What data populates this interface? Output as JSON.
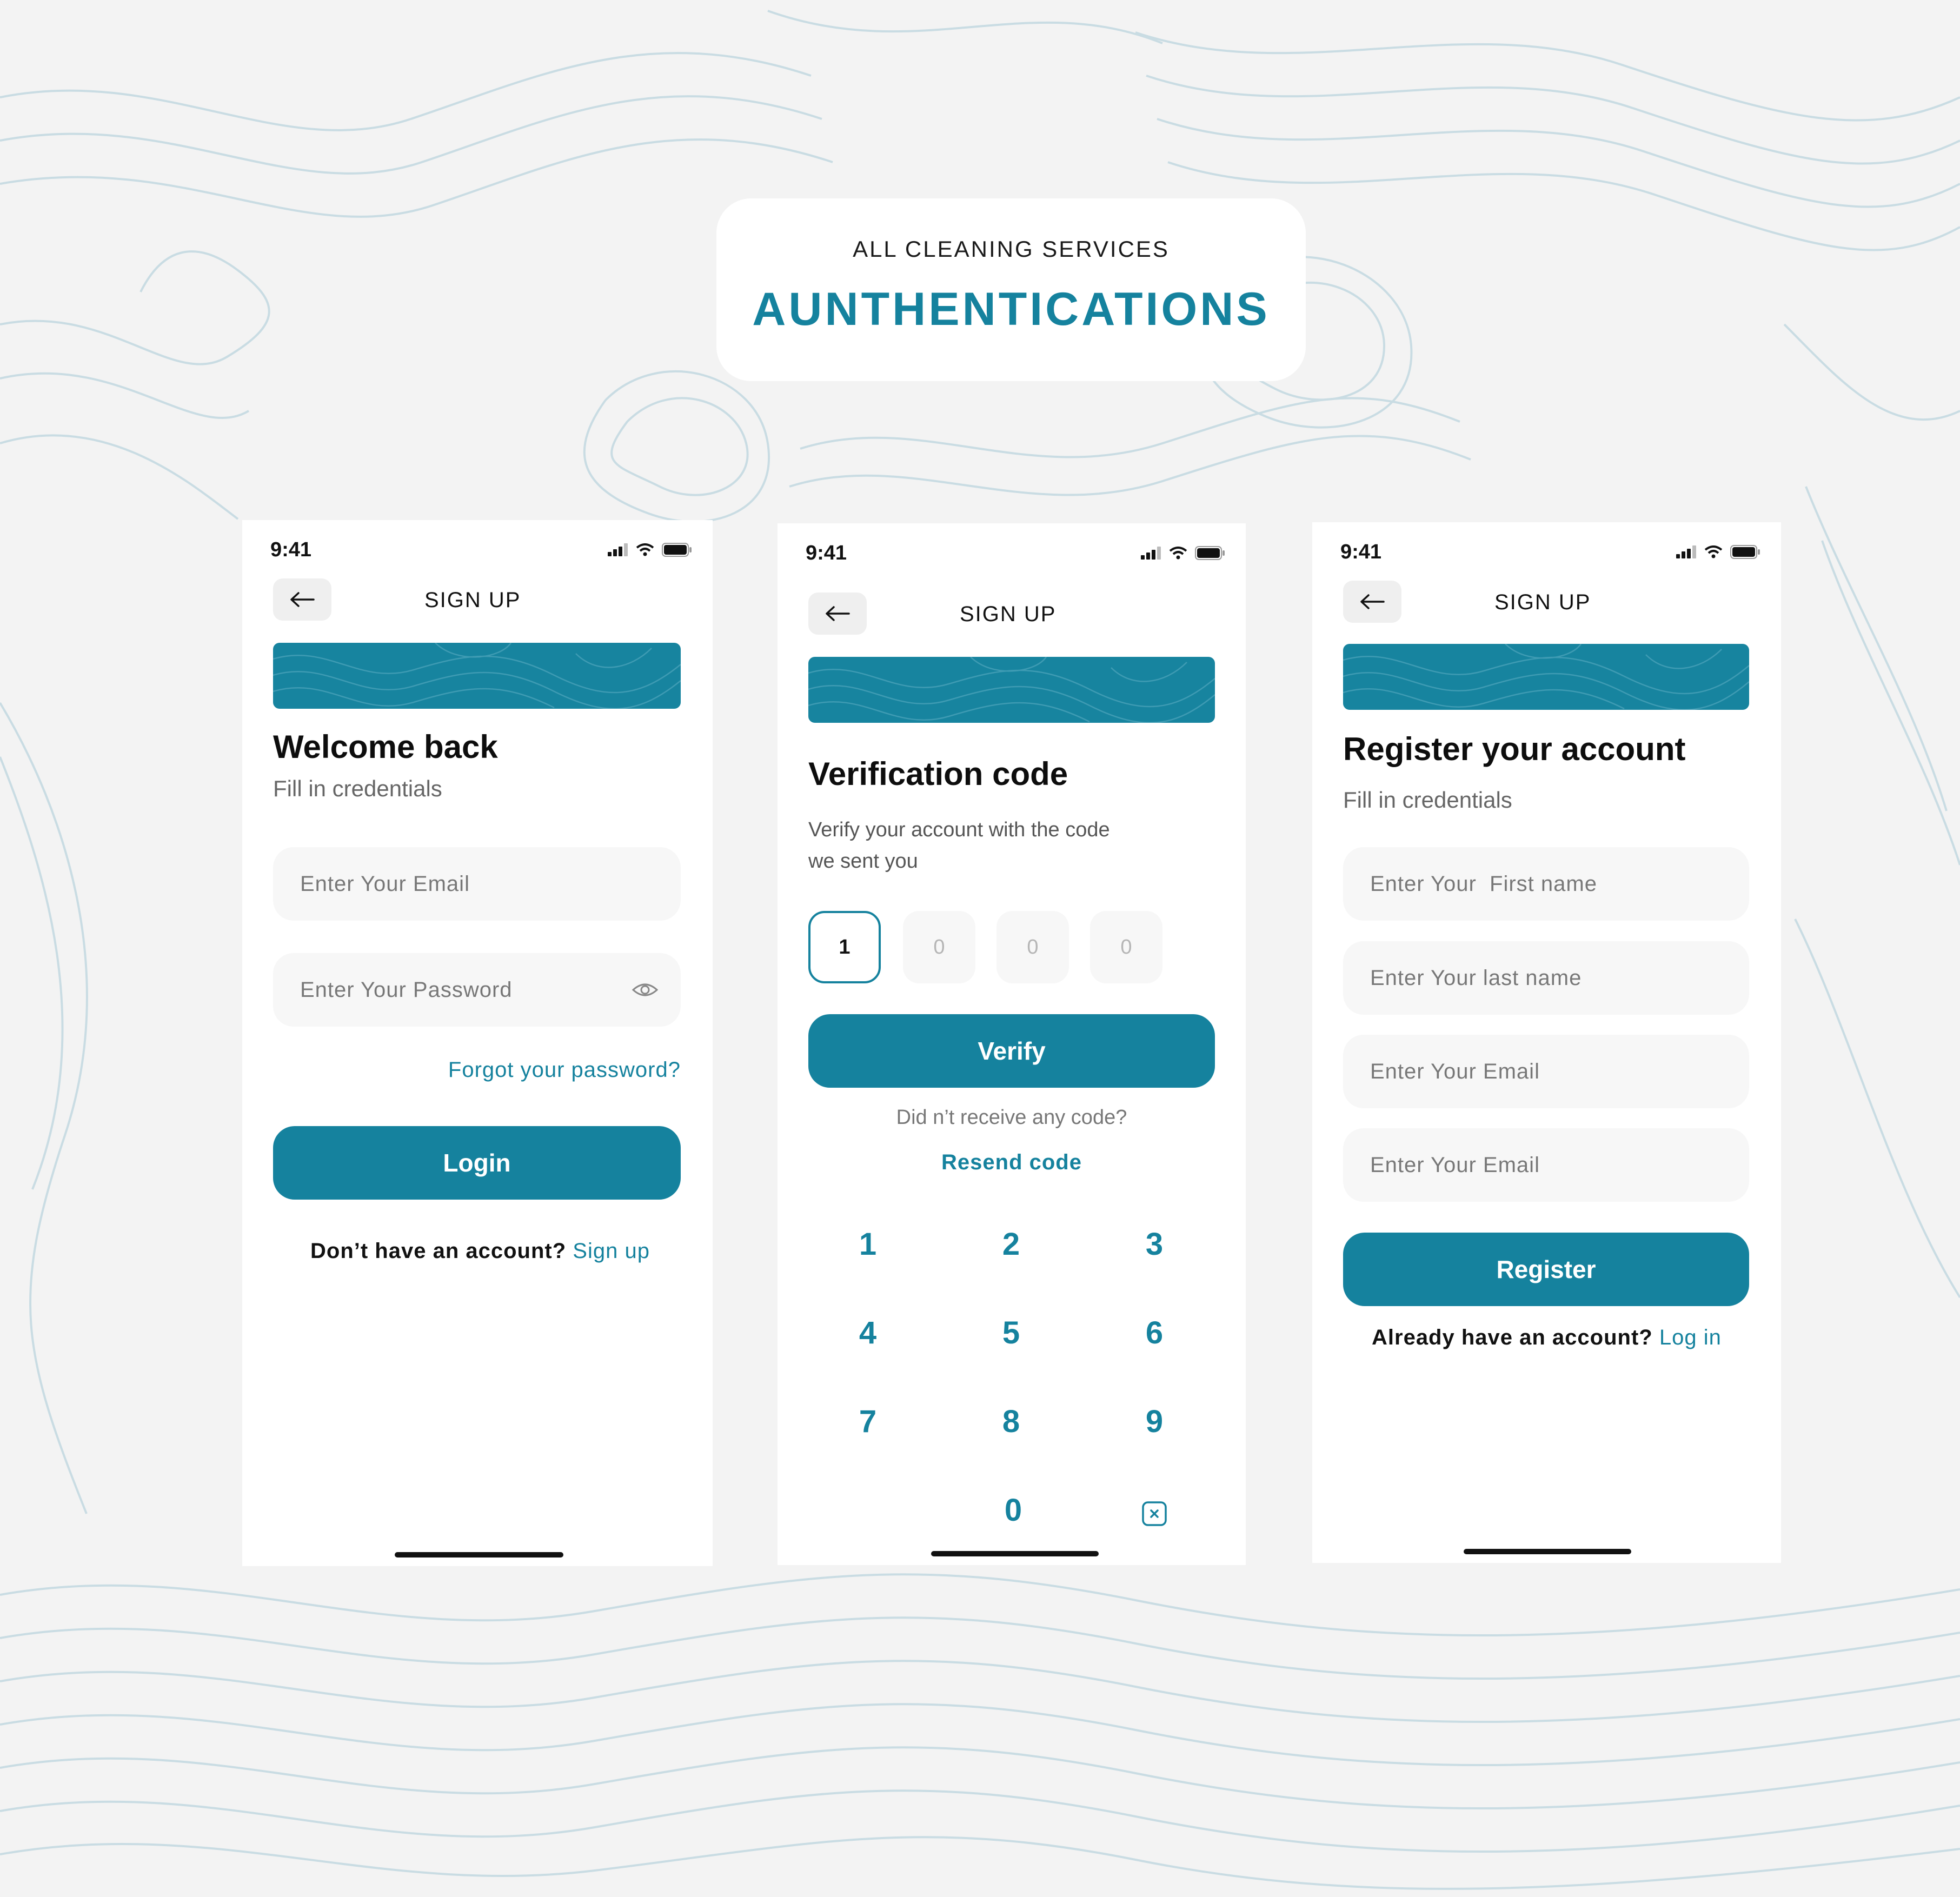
{
  "header": {
    "subtitle": "ALL CLEANING SERVICES",
    "title": "AUNTHENTICATIONS"
  },
  "colors": {
    "accent": "#15829e",
    "background": "#f3f3f3",
    "field": "#f7f7f7"
  },
  "screens": {
    "login": {
      "time": "9:41",
      "nav_title": "SIGN UP",
      "heading": "Welcome back",
      "subheading": "Fill in credentials",
      "email_placeholder": "Enter Your Email",
      "password_placeholder": "Enter Your Password",
      "forgot_link": "Forgot your password?",
      "login_button": "Login",
      "footer_prefix": "Don’t have an account?",
      "footer_link": "Sign up"
    },
    "verify": {
      "time": "9:41",
      "nav_title": "SIGN UP",
      "heading": "Verification code",
      "desc_line1": "Verify your account with the code",
      "desc_line2": "we sent you",
      "code_digits": [
        "1",
        "0",
        "0",
        "0"
      ],
      "verify_button": "Verify",
      "no_code_text": "Did n’t receive any code?",
      "resend_link": "Resend code",
      "keypad": [
        "1",
        "2",
        "3",
        "4",
        "5",
        "6",
        "7",
        "8",
        "9",
        "0"
      ]
    },
    "register": {
      "time": "9:41",
      "nav_title": "SIGN UP",
      "heading": "Register your account",
      "subheading": "Fill in credentials",
      "first_name_placeholder": "Enter Your  First name",
      "last_name_placeholder": "Enter Your last name",
      "email_placeholder": "Enter Your Email",
      "email2_placeholder": "Enter Your Email",
      "register_button": "Register",
      "footer_prefix": "Already have an account?",
      "footer_link": "Log in"
    }
  },
  "icons": [
    "back-arrow-icon",
    "signal-icon",
    "wifi-icon",
    "battery-icon",
    "eye-icon",
    "delete-key-icon"
  ]
}
